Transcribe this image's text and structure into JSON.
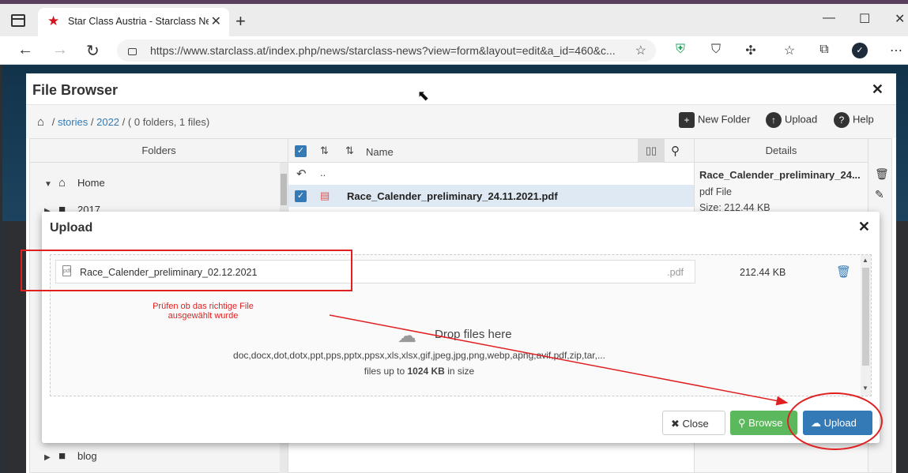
{
  "browser": {
    "tab_title": "Star Class Austria - Starclass New",
    "url": "https://www.starclass.at/index.php/news/starclass-news?view=form&layout=edit&a_id=460&c..."
  },
  "file_browser": {
    "title": "File Browser",
    "breadcrumb": {
      "sep": "/",
      "dir1": "stories",
      "dir2": "2022",
      "summary": "( 0 folders, 1 files)"
    },
    "toolbar": {
      "new_folder": "New Folder",
      "upload": "Upload",
      "help": "Help"
    },
    "folders_header": "Folders",
    "tree": [
      {
        "label": "Home"
      },
      {
        "label": "2017"
      },
      {
        "label": "blog"
      }
    ],
    "name_header": "Name",
    "parent_dots": "..",
    "file_name": "Race_Calender_preliminary_24.11.2021.pdf",
    "details_header": "Details",
    "details": {
      "name": "Race_Calender_preliminary_24...",
      "type": "pdf File",
      "size": "Size: 212.44 KB"
    }
  },
  "upload": {
    "title": "Upload",
    "file_name": "Race_Calender_preliminary_02.12.2021",
    "file_ext": ".pdf",
    "file_size": "212.44 KB",
    "drop_message": "Drop files here",
    "extensions": "doc,docx,dot,dotx,ppt,pps,pptx,ppsx,xls,xlsx,gif,jpeg,jpg,png,webp,apng,avif,pdf,zip,tar,...",
    "limit_prefix": "files up to",
    "limit_value": "1024 KB",
    "limit_suffix": "in size",
    "close_label": "Close",
    "browse_label": "Browse",
    "upload_label": "Upload"
  },
  "annotation": {
    "line1": "Prüfen ob das richtige File",
    "line2": "ausgewählt wurde",
    "color": "#e02020"
  },
  "colors": {
    "primary": "#337ab7",
    "success": "#5cb85c"
  }
}
